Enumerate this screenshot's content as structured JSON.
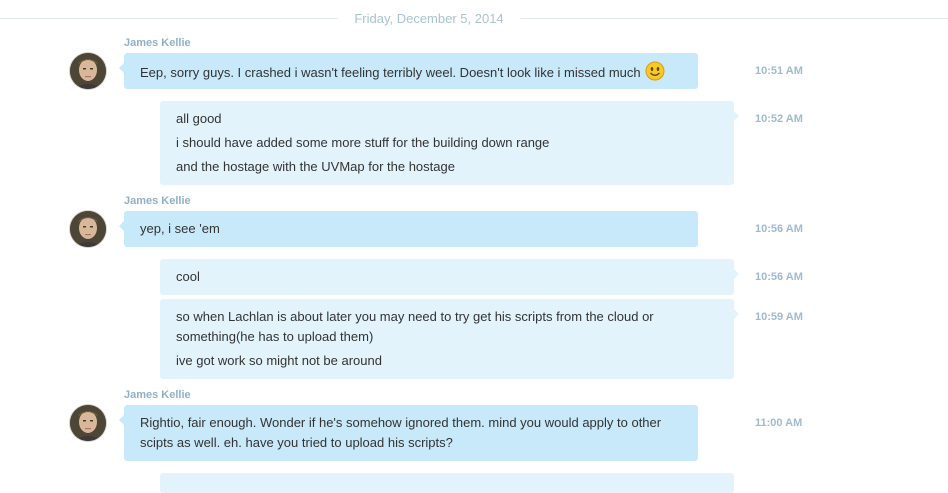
{
  "date_divider": "Friday, December 5, 2014",
  "messages": [
    {
      "sender": "James Kellie",
      "lines": [
        "Eep, sorry guys. I crashed i wasn't feeling terribly weel. Doesn't look like i missed much"
      ],
      "emoticon": "smile-emoticon",
      "time": "10:51 AM"
    },
    {
      "lines": [
        "all good",
        "i should have added some more stuff for the building down range",
        "and the hostage with the UVMap for the hostage"
      ],
      "time": "10:52 AM"
    },
    {
      "sender": "James Kellie",
      "lines": [
        "yep, i see 'em"
      ],
      "time": "10:56 AM"
    },
    {
      "lines": [
        "cool"
      ],
      "time": "10:56 AM"
    },
    {
      "lines": [
        "so when Lachlan is about later you may need to try get his scripts from the cloud or",
        "something(he has to upload them)",
        "ive got work so might not be around"
      ],
      "time": "10:59 AM"
    },
    {
      "sender": "James Kellie",
      "lines": [
        "Rightio, fair enough. Wonder if he's somehow ignored them. mind you would apply to other",
        "scipts as well. eh. have you tried to upload his scripts?"
      ],
      "time": "11:00 AM"
    }
  ],
  "colors": {
    "incoming_bubble": "#c7e9fa",
    "outgoing_bubble": "#e2f3fb",
    "time_text": "#9fbccd",
    "sender_text": "#8fb1c6"
  }
}
